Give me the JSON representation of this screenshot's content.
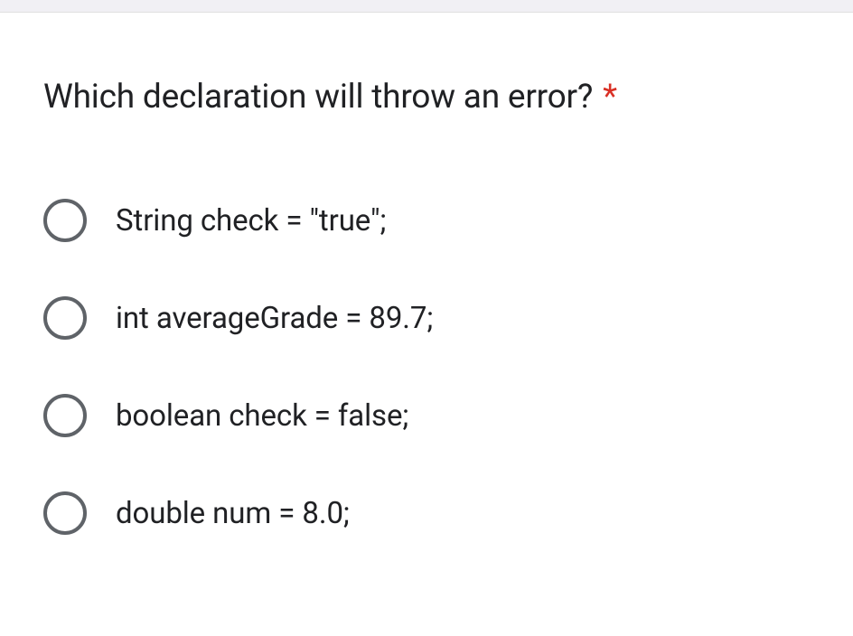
{
  "question": {
    "text": "Which declaration will throw an error?",
    "required_marker": "*"
  },
  "options": [
    {
      "label": "String check = \"true\";"
    },
    {
      "label": "int averageGrade = 89.7;"
    },
    {
      "label": "boolean check = false;"
    },
    {
      "label": "double num = 8.0;"
    }
  ]
}
